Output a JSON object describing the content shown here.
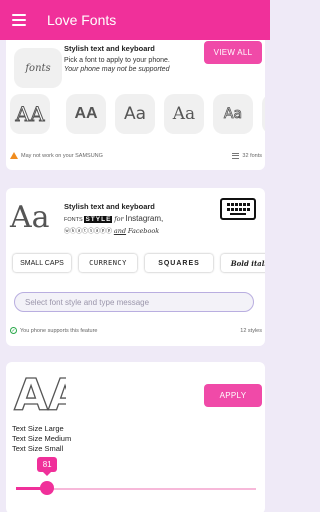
{
  "app": {
    "title": "Love Fonts",
    "accent": "#f0309a"
  },
  "card1": {
    "logo_text": "fonts",
    "title": "Stylish text and keyboard",
    "desc": "Pick a font to apply to your phone.",
    "warning": "Your phone may not be supported",
    "button": "VIEW ALL",
    "tiles": [
      "AA",
      "AA",
      "Aa",
      "Aa",
      "Aa",
      "Aa"
    ],
    "footer_left": "May not work on your SAMSUNG",
    "footer_right": "32 fonts"
  },
  "card2": {
    "big_text": "Aa",
    "title": "Stylish text and keyboard",
    "line1_a": "FONTS",
    "line1_b": "STYLE",
    "line1_c": "for",
    "line1_d": "Instagram,",
    "line2_a": "ⓦⓗⓐⓣⓢⓐⓟⓟ",
    "line2_b": "and",
    "line2_c": "Facebook",
    "chips": [
      "SMALL CAPS",
      "CURRENCY",
      "SQUARES",
      "Bold italic"
    ],
    "search_placeholder": "Select font style and type message",
    "footer_left": "You phone supports this feature",
    "footer_right": "12 styles"
  },
  "card3": {
    "icon_text": "AA",
    "button": "APPLY",
    "sizes": [
      "Text Size Large",
      "Text Size Medium",
      "Text Size Small"
    ],
    "slider_value": "81",
    "slider_fraction": 0.13
  }
}
